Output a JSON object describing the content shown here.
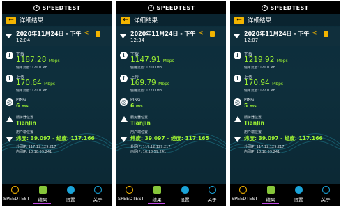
{
  "app": {
    "title": "SPEEDTEST",
    "screen_title": "详细结果"
  },
  "labels": {
    "download": "下载",
    "upload": "上传",
    "ping": "PING",
    "server_location": "服务器位置",
    "user_location": "用户端位置",
    "usage_prefix": "使用流量:",
    "external_ip_prefix": "外网IP:",
    "internal_ip_prefix": "内网IP:"
  },
  "icons": {
    "gauge": "speedometer-icon",
    "back": "back-arrow-icon",
    "wifi": "wifi-icon",
    "share": "share-icon",
    "delete": "trash-icon",
    "download": "download-arrow-icon",
    "upload": "upload-arrow-icon",
    "ping": "ping-icon",
    "server": "server-pin-icon",
    "user": "user-pin-icon"
  },
  "tabs": [
    {
      "label": "SPEEDTEST",
      "icon": "speedometer-icon"
    },
    {
      "label": "结果",
      "icon": "results-icon",
      "active": true
    },
    {
      "label": "设置",
      "icon": "settings-gear-icon"
    },
    {
      "label": "关于",
      "icon": "info-icon"
    }
  ],
  "colors": {
    "accent_green": "#9df233",
    "accent_orange": "#f3b400",
    "active_tab_underline": "#c34ae6"
  },
  "panels": [
    {
      "date": "2020年11月24日 - 下午",
      "time": "12:04",
      "download": {
        "value": "1187.28",
        "unit": "Mbps",
        "usage": "120.0 MB"
      },
      "upload": {
        "value": "170.64",
        "unit": "Mbps",
        "usage": "121.0 MB"
      },
      "ping": {
        "value": "6",
        "unit": "ms"
      },
      "server_location": "TianJin",
      "coords": "纬度: 39.097 - 经度: 117.166",
      "external_ip": "117.12.129.217",
      "internal_ip": "10.18.59.241"
    },
    {
      "date": "2020年11月24日 - 下午",
      "time": "12:34",
      "download": {
        "value": "1147.91",
        "unit": "Mbps",
        "usage": "120.0 MB"
      },
      "upload": {
        "value": "169.79",
        "unit": "Mbps",
        "usage": "122.0 MB"
      },
      "ping": {
        "value": "6",
        "unit": "ms"
      },
      "server_location": "TianJin",
      "coords": "纬度: 39.097 - 经度: 117.165",
      "external_ip": "117.12.129.217",
      "internal_ip": "10.18.59.241"
    },
    {
      "date": "2020年11月24日 - 下午",
      "time": "12:07",
      "download": {
        "value": "1219.92",
        "unit": "Mbps",
        "usage": "120.0 MB"
      },
      "upload": {
        "value": "170.94",
        "unit": "Mbps",
        "usage": "122.0 MB"
      },
      "ping": {
        "value": "5",
        "unit": "ms"
      },
      "server_location": "TianJin",
      "coords": "纬度: 39.097 - 经度: 117.166",
      "external_ip": "117.12.129.217",
      "internal_ip": "10.18.59.241"
    }
  ]
}
